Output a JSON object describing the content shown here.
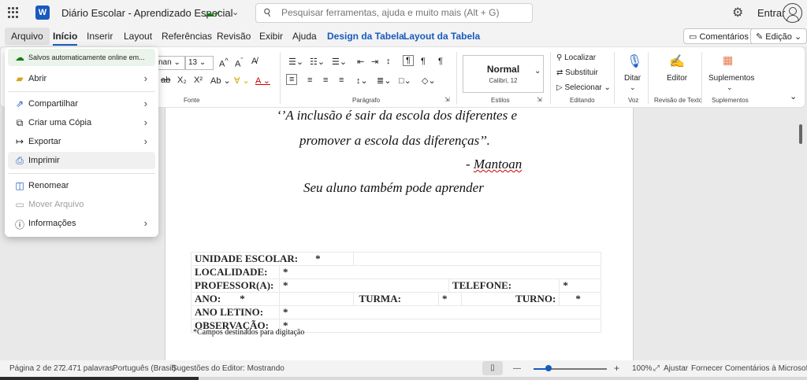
{
  "titlebar": {
    "app_icon": "W",
    "doc_title": "Diário Escolar - Aprendizado Especial",
    "search_placeholder": "Pesquisar ferramentas, ajuda e muito mais (Alt + G)",
    "signin": "Entrar"
  },
  "menubar": {
    "tabs": [
      "Arquivo",
      "Início",
      "Inserir",
      "Layout",
      "Referências",
      "Revisão",
      "Exibir",
      "Ajuda",
      "Design da Tabela",
      "Layout da Tabela"
    ],
    "comments": "Comentários",
    "editing": "Edição"
  },
  "ribbon": {
    "font_name": "nan",
    "font_size": "13",
    "font_group": "Fonte",
    "paragraph_group": "Parágrafo",
    "styles_group": "Estilos",
    "style_name": "Normal",
    "style_sub": "Calibri, 12",
    "editing_group": "Editando",
    "find": "Localizar",
    "replace": "Substituir",
    "select": "Selecionar",
    "dictate": "Ditar",
    "voice_group": "Voz",
    "editor": "Editor",
    "review_group": "Revisão de Texto",
    "addins": "Suplementos",
    "addins_group": "Suplementos"
  },
  "file_menu": {
    "saved_status": "Salvos automaticamente online em...",
    "items": [
      {
        "label": "Abrir",
        "icon": "folder-icon"
      },
      {
        "label": "Compartilhar",
        "icon": "share-icon"
      },
      {
        "label": "Criar uma Cópia",
        "icon": "copy-icon"
      },
      {
        "label": "Exportar",
        "icon": "export-icon"
      },
      {
        "label": "Imprimir",
        "icon": "printer-icon"
      },
      {
        "label": "Renomear",
        "icon": "rename-icon"
      },
      {
        "label": "Mover Arquivo",
        "icon": "move-file-icon"
      },
      {
        "label": "Informações",
        "icon": "info-icon"
      }
    ]
  },
  "document": {
    "quote_line1": "‘’A inclusão é sair da escola dos diferentes e",
    "quote_line2": "promover a escola das diferenças’’.",
    "author_dash": "- ",
    "author": "Mantoan",
    "subtitle": "Seu aluno também pode aprender",
    "table": {
      "unidade": "UNIDADE ESCOLAR:",
      "localidade": "LOCALIDADE:",
      "professor": "PROFESSOR(A):",
      "telefone": "TELEFONE:",
      "ano": "ANO:",
      "turma": "TURMA:",
      "turno": "TURNO:",
      "ano_letivo": "ANO LETINO:",
      "observacao": "OBSERVAÇÃO:",
      "star": "*"
    },
    "footnote": "*Campos destinados para digitação"
  },
  "statusbar": {
    "page": "Página 2 de 27",
    "words": "2.471 palavras",
    "language": "Português (Brasil)",
    "editor_suggestions": "Sugestões do Editor: Mostrando",
    "zoom_minus": "—",
    "zoom_plus": "+",
    "zoom": "100%",
    "fit": "Ajustar",
    "feedback": "Fornecer Comentários à Microsoft",
    "zoom_fraction": 0.2
  },
  "colors": {
    "accent": "#185abd",
    "saved": "#107c10"
  }
}
